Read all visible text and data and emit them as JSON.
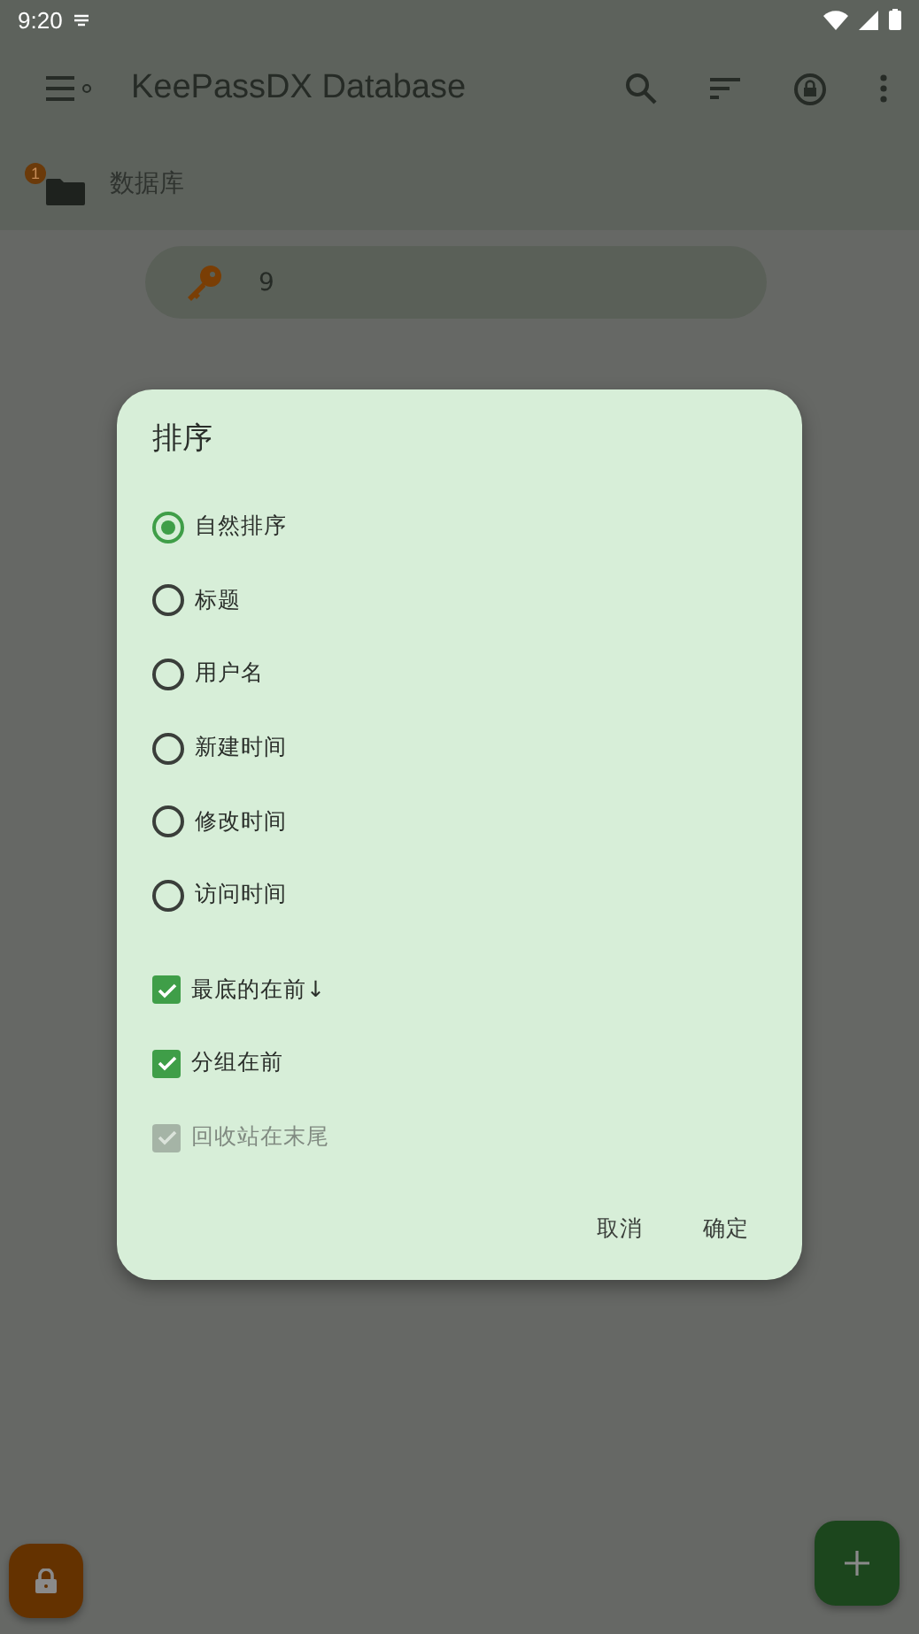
{
  "status_bar": {
    "time": "9:20"
  },
  "toolbar": {
    "title": "KeePassDX Database"
  },
  "breadcrumb": {
    "label": "数据库",
    "badge": "1"
  },
  "entries": [
    {
      "title": "9"
    }
  ],
  "dialog": {
    "title": "排序",
    "options": [
      {
        "label": "自然排序",
        "selected": true
      },
      {
        "label": "标题",
        "selected": false
      },
      {
        "label": "用户名",
        "selected": false
      },
      {
        "label": "新建时间",
        "selected": false
      },
      {
        "label": "修改时间",
        "selected": false
      },
      {
        "label": "访问时间",
        "selected": false
      }
    ],
    "checks": [
      {
        "label": "最底的在前↓",
        "checked": true,
        "disabled": false
      },
      {
        "label": "分组在前",
        "checked": true,
        "disabled": false
      },
      {
        "label": "回收站在末尾",
        "checked": true,
        "disabled": true
      }
    ],
    "buttons": [
      "取消",
      "确定"
    ]
  }
}
